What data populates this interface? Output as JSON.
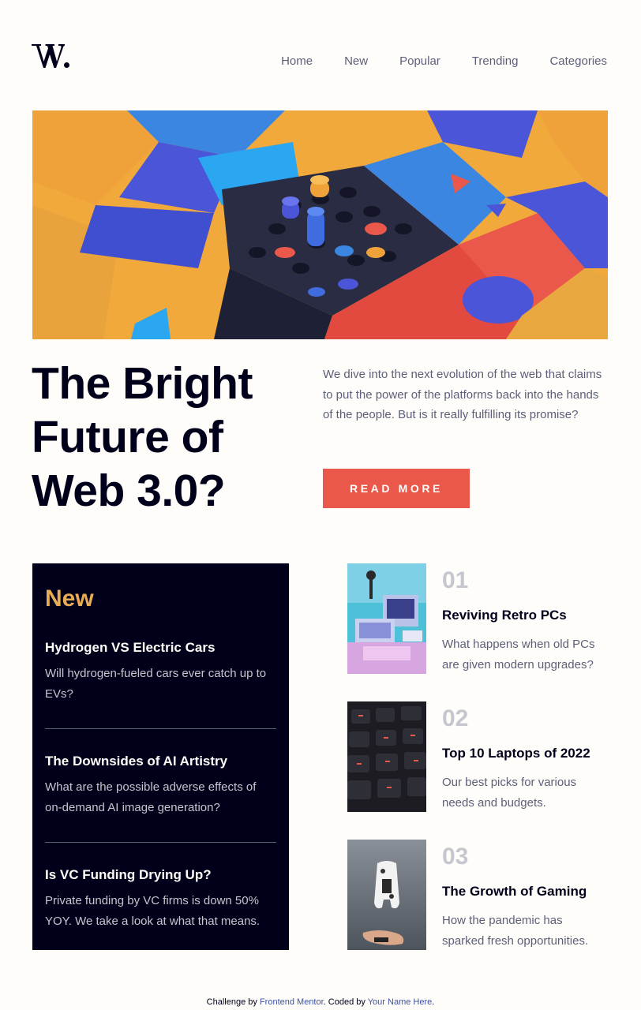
{
  "header": {
    "logo_text": "W.",
    "nav": [
      "Home",
      "New",
      "Popular",
      "Trending",
      "Categories"
    ]
  },
  "hero": {
    "title": "The Bright Future of Web 3.0?",
    "description": "We dive into the next evolution of the web that claims to put the power of the platforms back into the hands of the people. But is it really fulfilling its promise?",
    "button_label": "READ MORE"
  },
  "new_panel": {
    "heading": "New",
    "items": [
      {
        "title": "Hydrogen VS Electric Cars",
        "desc": "Will hydrogen-fueled cars ever catch up to EVs?"
      },
      {
        "title": "The Downsides of AI Artistry",
        "desc": "What are the possible adverse effects of on-demand AI image generation?"
      },
      {
        "title": "Is VC Funding Drying Up?",
        "desc": "Private funding by VC firms is down 50% YOY. We take a look at what that means."
      }
    ]
  },
  "numbered": [
    {
      "num": "01",
      "title": "Reviving Retro PCs",
      "desc": "What happens when old PCs are given modern upgrades?"
    },
    {
      "num": "02",
      "title": "Top 10 Laptops of 2022",
      "desc": "Our best picks for various needs and budgets."
    },
    {
      "num": "03",
      "title": "The Growth of Gaming",
      "desc": "How the pandemic has sparked fresh opportunities."
    }
  ],
  "footer": {
    "prefix": "Challenge by ",
    "link1": "Frontend Mentor",
    "middle": ". Coded by ",
    "link2": "Your Name Here",
    "suffix": "."
  },
  "colors": {
    "accent_red": "#e9584b",
    "accent_orange": "#e9ab53",
    "dark_navy": "#00001a",
    "grayish_blue": "#5d5f79",
    "off_white": "#fffdfa"
  }
}
